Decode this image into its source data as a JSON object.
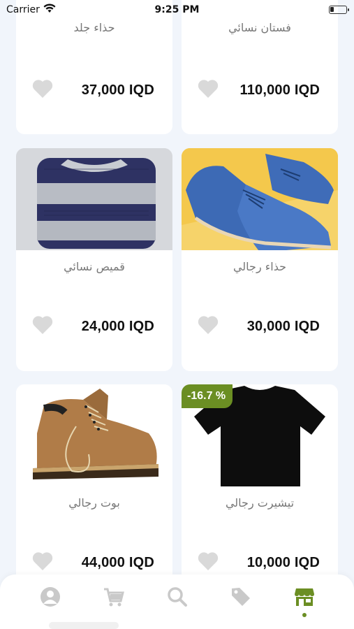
{
  "status_bar": {
    "carrier": "Carrier",
    "time": "9:25 PM"
  },
  "products": [
    {
      "name": "فستان نسائي",
      "price": "110,000 IQD"
    },
    {
      "name": "حذاء جلد",
      "price": "37,000 IQD"
    },
    {
      "name": "حذاء رجالي",
      "price": "30,000 IQD"
    },
    {
      "name": "قميص نسائي",
      "price": "24,000 IQD"
    },
    {
      "name": "تيشيرت رجالي",
      "price": "10,000 IQD",
      "discount": "-16.7 %"
    },
    {
      "name": "بوت رجالي",
      "price": "44,000 IQD"
    }
  ],
  "tab_bar": {
    "tabs": [
      "profile-icon",
      "cart-icon",
      "search-icon",
      "tag-icon",
      "store-icon"
    ],
    "active_tab": "store-icon",
    "active_color": "#6b8e23",
    "inactive_color": "#c9c9c9"
  }
}
